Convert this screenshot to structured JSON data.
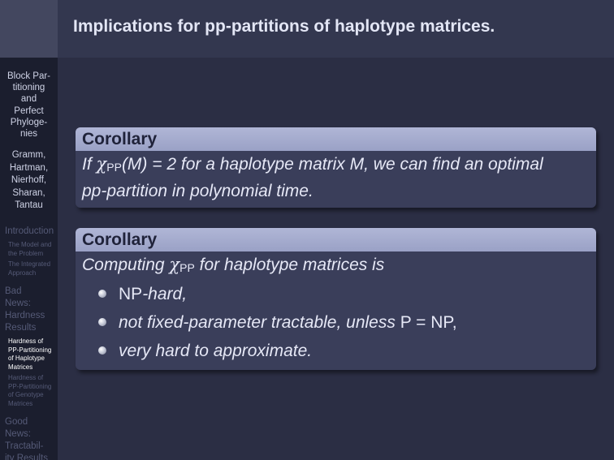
{
  "sidebar": {
    "title_lines": [
      "Block Par-",
      "titioning",
      "and",
      "Perfect",
      "Phyloge-",
      "nies"
    ],
    "authors": [
      "Gramm,",
      "Hartman,",
      "Nierhoff,",
      "Sharan,",
      "Tantau"
    ],
    "sections": [
      {
        "lines": [
          "Introduction"
        ]
      },
      {
        "lines": [
          "Bad",
          "News:",
          "Hardness",
          "Results"
        ]
      },
      {
        "lines": [
          "Good",
          "News:",
          "Tractabil-",
          "ity Results"
        ]
      }
    ],
    "subsections": [
      {
        "lines": [
          "The Model and",
          "the Problem"
        ],
        "active": false
      },
      {
        "lines": [
          "The Integrated",
          "Approach"
        ],
        "active": false
      },
      {
        "lines": [
          "Hardness of",
          "PP-Partitioning",
          "of Haplotype",
          "Matrices"
        ],
        "active": true
      },
      {
        "lines": [
          "Hardness of",
          "PP-Partitioning",
          "of Genotype",
          "Matrices"
        ],
        "active": false
      }
    ]
  },
  "frame": {
    "title": "Implications for pp-partitions of haplotype matrices."
  },
  "corollary1": {
    "heading": "Corollary",
    "if": "If ",
    "chi": "χ",
    "sub": "PP",
    "arg": "(M) = 2",
    "rest_line1": " for a haplotype matrix M, we can find an optimal",
    "line2": "pp-partition in polynomial time."
  },
  "corollary2": {
    "heading": "Corollary",
    "pre": "Computing ",
    "chi": "χ",
    "sub": "PP",
    "post": " for haplotype matrices is",
    "item1_normal": "NP",
    "item1_italic": "-hard,",
    "item2_italic": "not fixed-parameter tractable, unless ",
    "item2_normal": "P = NP,",
    "item3_italic": "very hard to approximate."
  }
}
